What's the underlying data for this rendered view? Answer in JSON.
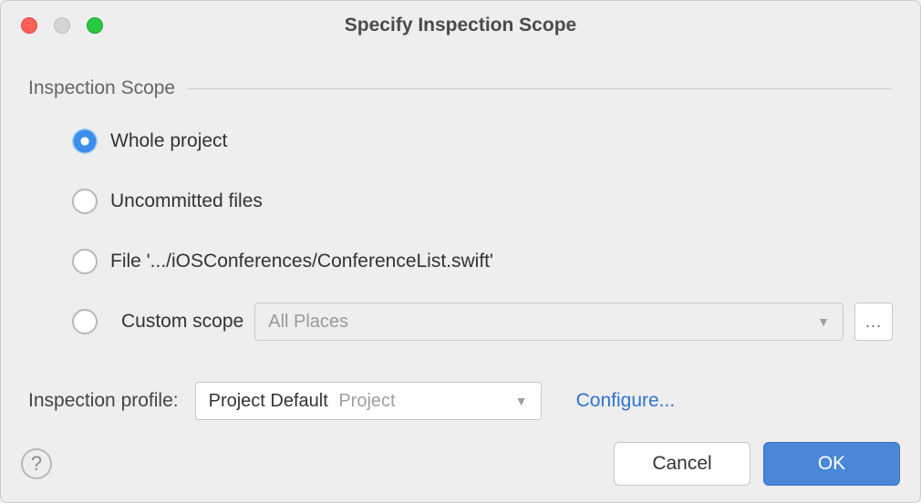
{
  "window": {
    "title": "Specify Inspection Scope"
  },
  "section": {
    "label": "Inspection Scope"
  },
  "radios": {
    "whole_project": "Whole project",
    "uncommitted": "Uncommitted files",
    "file": "File '.../iOSConferences/ConferenceList.swift'",
    "custom_scope": "Custom scope"
  },
  "custom_scope_select": {
    "value": "All Places"
  },
  "ellipsis": "...",
  "profile": {
    "label": "Inspection profile:",
    "value_main": "Project Default",
    "value_sub": "Project",
    "configure": "Configure..."
  },
  "buttons": {
    "help": "?",
    "cancel": "Cancel",
    "ok": "OK"
  }
}
